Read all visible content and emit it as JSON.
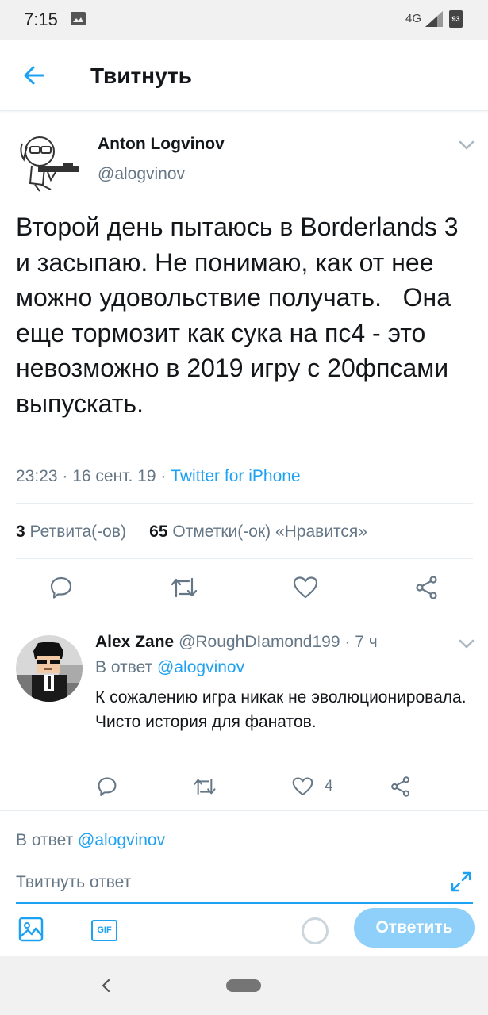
{
  "status_bar": {
    "time": "7:15",
    "network": "4G",
    "battery": "93"
  },
  "header": {
    "title": "Твитнуть"
  },
  "tweet": {
    "author_name": "Anton Logvinov",
    "author_handle": "@alogvinov",
    "text": "Второй день пытаюсь в Borderlands 3 и засыпаю. Не понимаю, как от нее можно удовольствие получать.   Она еще тормозит как сука на пс4 - это невозможно в 2019 игру с 20фпсами выпускать.",
    "time": "23:23",
    "date": "16 сент. 19",
    "source": "Twitter for iPhone",
    "retweet_count": "3",
    "retweet_label": "Ретвита(-ов)",
    "like_count": "65",
    "like_label": "Отметки(-ок) «Нравится»"
  },
  "reply": {
    "author_name": "Alex Zane",
    "author_handle": "@RoughDIamond199",
    "age": "7 ч",
    "reply_prefix": "В ответ",
    "reply_mention": "@alogvinov",
    "text": "К сожалению игра никак не эволюционировала. Чисто история для фанатов.",
    "like_count": "4"
  },
  "composer": {
    "reply_prefix": "В ответ",
    "reply_mention": "@alogvinov",
    "placeholder": "Твитнуть ответ",
    "gif_label": "GIF",
    "submit_label": "Ответить"
  },
  "colors": {
    "accent": "#1da1f2",
    "text": "#14171a",
    "muted": "#657786",
    "divider": "#e6ecf0",
    "submit_disabled": "#8ed0f9"
  },
  "icons": [
    "image-icon",
    "back-arrow-icon",
    "chevron-down-icon",
    "reply-icon",
    "retweet-icon",
    "like-icon",
    "share-icon",
    "expand-icon",
    "gif-icon"
  ]
}
